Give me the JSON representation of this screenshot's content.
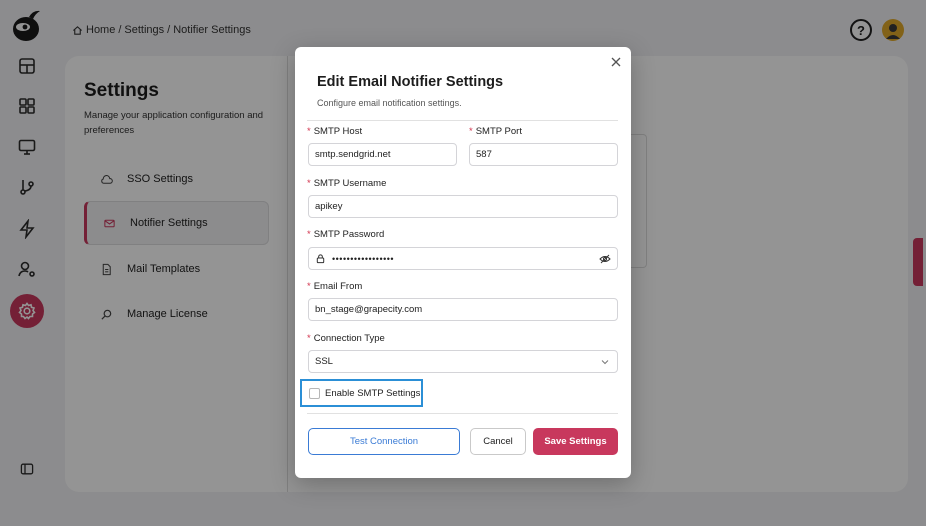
{
  "breadcrumb": {
    "home": "Home",
    "sep1": "/",
    "settings": "Settings",
    "sep2": "/",
    "current": "Notifier Settings"
  },
  "header": {
    "help": "?"
  },
  "page": {
    "title": "Settings",
    "subtitle": "Manage your application configuration and preferences",
    "menu": [
      {
        "label": "SSO Settings",
        "icon": "cloud-icon"
      },
      {
        "label": "Notifier Settings",
        "icon": "mail-icon",
        "active": true
      },
      {
        "label": "Mail Templates",
        "icon": "document-icon"
      },
      {
        "label": "Manage License",
        "icon": "search-icon"
      }
    ]
  },
  "modal": {
    "title": "Edit Email Notifier Settings",
    "subtitle": "Configure email notification settings.",
    "fields": {
      "smtp_host": {
        "label": "SMTP Host",
        "value": "smtp.sendgrid.net"
      },
      "smtp_port": {
        "label": "SMTP Port",
        "value": "587"
      },
      "smtp_username": {
        "label": "SMTP Username",
        "value": "apikey"
      },
      "smtp_password": {
        "label": "SMTP Password",
        "value": "•••••••••••••••••"
      },
      "email_from": {
        "label": "Email From",
        "value": "bn_stage@grapecity.com"
      },
      "connection_type": {
        "label": "Connection Type",
        "value": "SSL"
      }
    },
    "required_mark": "*",
    "enable_smtp": {
      "label": "Enable SMTP Settings",
      "checked": false
    },
    "buttons": {
      "test": "Test Connection",
      "cancel": "Cancel",
      "save": "Save Settings"
    }
  },
  "colors": {
    "accent": "#c8385d",
    "link": "#3a7bd5",
    "focus": "#2b8fd6"
  }
}
